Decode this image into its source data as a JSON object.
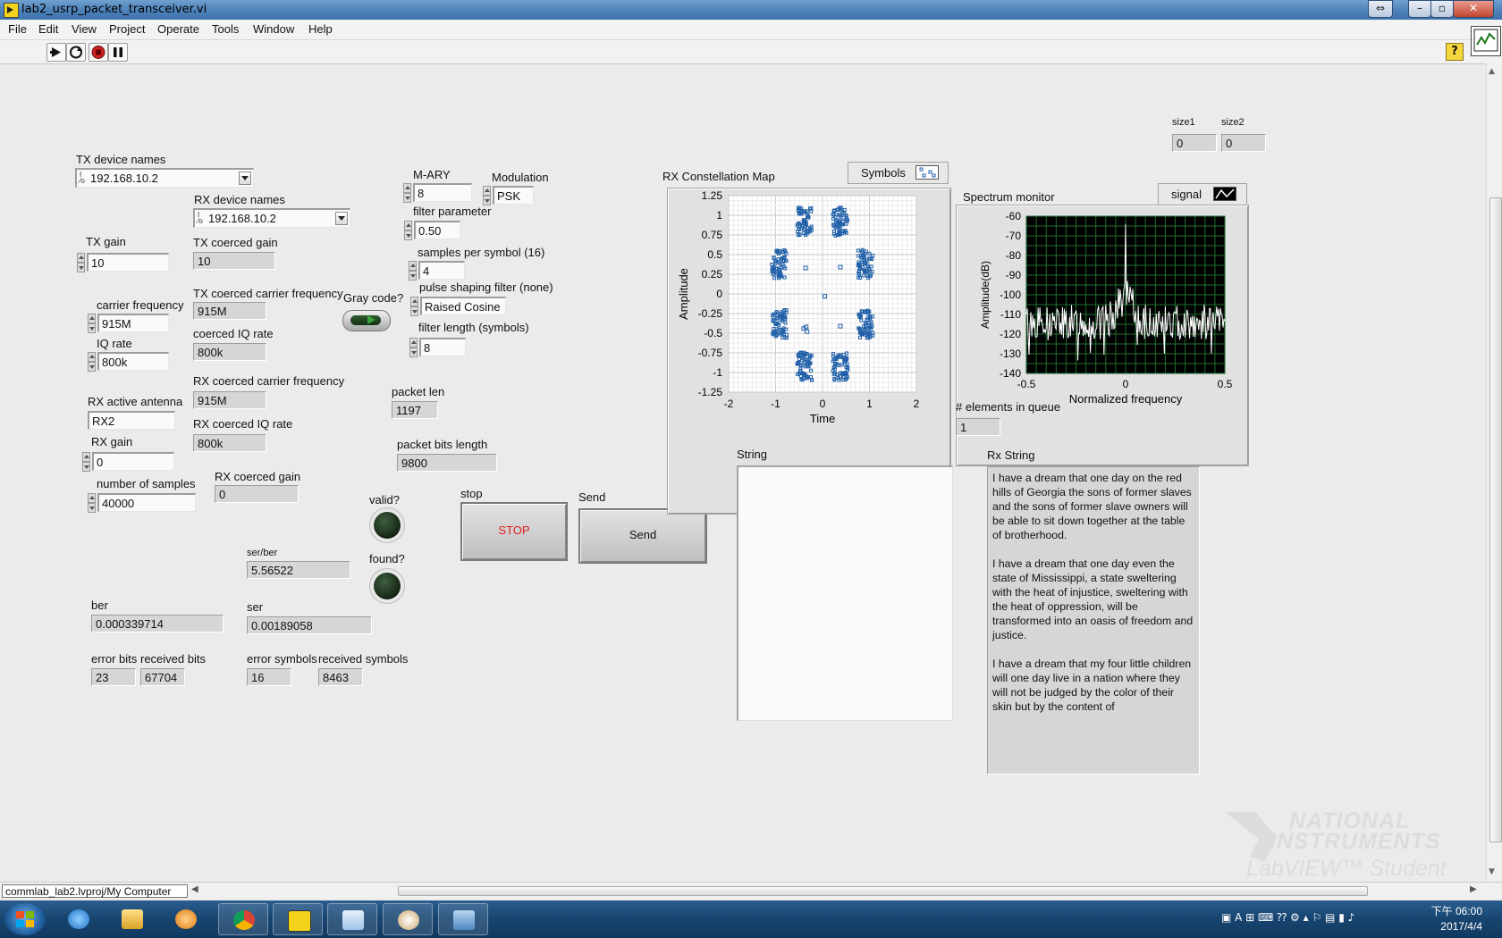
{
  "window": {
    "title": "lab2_usrp_packet_transceiver.vi"
  },
  "menu": [
    "File",
    "Edit",
    "View",
    "Project",
    "Operate",
    "Tools",
    "Window",
    "Help"
  ],
  "toolbar": {
    "help": "?",
    "vi_badge": "VI\n1"
  },
  "controls": {
    "tx_device_names": {
      "label": "TX device names",
      "value": "192.168.10.2"
    },
    "rx_device_names": {
      "label": "RX device names",
      "value": "192.168.10.2"
    },
    "tx_gain": {
      "label": "TX gain",
      "value": "10"
    },
    "tx_coerced_gain": {
      "label": "TX coerced gain",
      "value": "10"
    },
    "carrier_frequency": {
      "label": "carrier frequency",
      "value": "915M"
    },
    "tx_coerced_carrier_frequency": {
      "label": "TX coerced carrier frequency",
      "value": "915M"
    },
    "iq_rate": {
      "label": "IQ rate",
      "value": "800k"
    },
    "coerced_iq_rate": {
      "label": "coerced IQ rate",
      "value": "800k"
    },
    "rx_active_antenna": {
      "label": "RX active antenna",
      "value": "RX2"
    },
    "rx_coerced_carrier_frequency": {
      "label": "RX coerced carrier frequency",
      "value": "915M"
    },
    "rx_gain": {
      "label": "RX gain",
      "value": "0"
    },
    "rx_coerced_iq_rate": {
      "label": "RX coerced IQ rate",
      "value": "800k"
    },
    "number_of_samples": {
      "label": "number of samples",
      "value": "40000"
    },
    "rx_coerced_gain": {
      "label": "RX coerced gain",
      "value": "0"
    },
    "gray_code": {
      "label": "Gray code?"
    },
    "m_ary": {
      "label": "M-ARY",
      "value": "8"
    },
    "modulation": {
      "label": "Modulation",
      "value": "PSK"
    },
    "filter_parameter": {
      "label": "filter parameter",
      "value": "0.50"
    },
    "samples_per_symbol": {
      "label": "samples per symbol (16)",
      "value": "4"
    },
    "pulse_shaping_filter": {
      "label": "pulse shaping filter (none)",
      "value": "Raised Cosine"
    },
    "filter_length": {
      "label": "filter length (symbols)",
      "value": "8"
    },
    "packet_len": {
      "label": "packet len",
      "value": "1197"
    },
    "packet_bits_length": {
      "label": "packet bits length",
      "value": "9800"
    },
    "valid": {
      "label": "valid?"
    },
    "found": {
      "label": "found?"
    },
    "stop": {
      "label": "stop",
      "text": "STOP"
    },
    "send": {
      "label": "Send",
      "text": "Send"
    },
    "ser_ber": {
      "label": "ser/ber",
      "value": "5.56522"
    },
    "ber": {
      "label": "ber",
      "value": "0.000339714"
    },
    "ser": {
      "label": "ser",
      "value": "0.00189058"
    },
    "error_bits": {
      "label": "error bits",
      "value": "23"
    },
    "received_bits": {
      "label": "received bits",
      "value": "67704"
    },
    "error_symbols": {
      "label": "error symbols",
      "value": "16"
    },
    "received_symbols": {
      "label": "received symbols",
      "value": "8463"
    },
    "size1": {
      "label": "size1",
      "value": "0"
    },
    "size2": {
      "label": "size2",
      "value": "0"
    },
    "elements_in_queue": {
      "label": "# elements in queue",
      "value": "1"
    },
    "string": {
      "label": "String",
      "value": ""
    },
    "rx_string": {
      "label": "Rx String",
      "value": "I have a dream that one day on the red hills of Georgia the sons of former slaves and the sons of former slave owners will be able to sit down together at the table of brotherhood.\n\nI have a dream that one day even the state of Mississippi, a state sweltering with the heat of injustice, sweltering with the heat of oppression, will be transformed into an oasis of freedom and justice.\n\nI have a dream that my four little children will one day live in a nation where they will not be judged by the color of their skin but by the content of"
    }
  },
  "chart_data": [
    {
      "type": "scatter",
      "title": "RX Constellation Map",
      "legend": "Symbols",
      "xlabel": "Time",
      "ylabel": "Amplitude",
      "xlim": [
        -2,
        2
      ],
      "ylim": [
        -1.25,
        1.25
      ],
      "xticks": [
        "-2",
        "-1",
        "0",
        "1",
        "2"
      ],
      "yticks": [
        "1.25",
        "1",
        "0.75",
        "0.5",
        "0.25",
        "0",
        "-0.25",
        "-0.5",
        "-0.75",
        "-1",
        "-1.25"
      ],
      "grid": true,
      "color": "#1f5fa8",
      "clusters": [
        {
          "x": -0.38,
          "y": 0.92
        },
        {
          "x": 0.38,
          "y": 0.92
        },
        {
          "x": -0.92,
          "y": 0.38
        },
        {
          "x": 0.92,
          "y": 0.38
        },
        {
          "x": -0.92,
          "y": -0.38
        },
        {
          "x": 0.92,
          "y": -0.38
        },
        {
          "x": -0.38,
          "y": -0.92
        },
        {
          "x": 0.38,
          "y": -0.92
        }
      ],
      "outliers": [
        {
          "x": -0.36,
          "y": 0.33
        },
        {
          "x": 0.38,
          "y": 0.34
        },
        {
          "x": 0.05,
          "y": -0.03
        },
        {
          "x": -0.4,
          "y": -0.44
        },
        {
          "x": -0.33,
          "y": -0.48
        },
        {
          "x": 0.38,
          "y": -0.41
        },
        {
          "x": -0.35,
          "y": -0.42
        }
      ]
    },
    {
      "type": "line",
      "title": "Spectrum monitor",
      "legend": "signal",
      "xlabel": "Normalized frequency",
      "ylabel": "Amplitude(dB)",
      "xlim": [
        -0.5,
        0.5
      ],
      "ylim": [
        -140,
        -60
      ],
      "xticks": [
        "-0.5",
        "0",
        "0.5"
      ],
      "yticks": [
        "-60",
        "-70",
        "-80",
        "-90",
        "-100",
        "-110",
        "-120",
        "-130",
        "-140"
      ],
      "grid": true,
      "color": "#ffffff",
      "background": "#000000",
      "grid_color": "#1f6f2f",
      "peak": {
        "x": 0,
        "y": -64
      }
    }
  ],
  "status": {
    "path": "commlab_lab2.lvproj/My Computer"
  },
  "watermark": {
    "line1": "NATIONAL",
    "line2": "INSTRUMENTS",
    "line3": "LabVIEW™ Student Edition"
  },
  "taskbar": {
    "time": "下午 06:00",
    "date": "2017/4/4"
  }
}
